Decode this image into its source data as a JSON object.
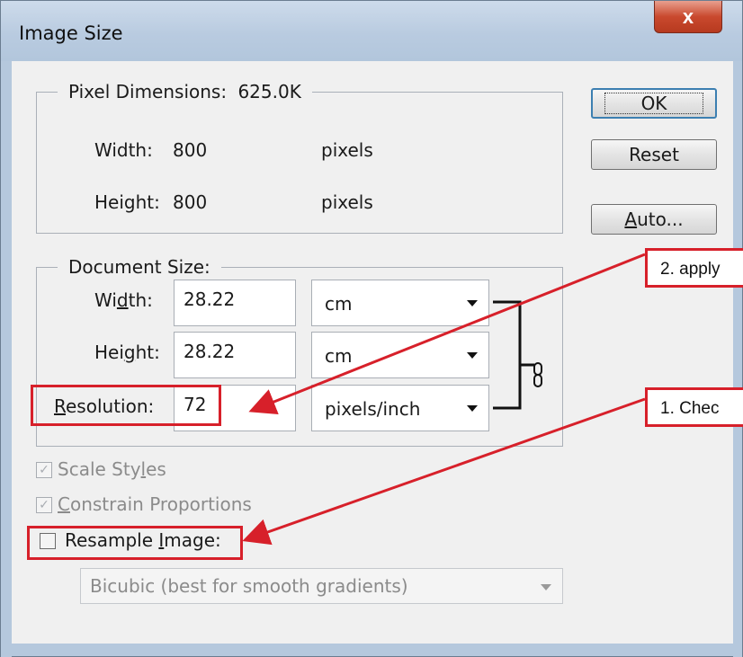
{
  "window": {
    "title": "Image Size",
    "close_glyph": "x"
  },
  "pixel_dimensions": {
    "legend": "Pixel Dimensions:",
    "size": "625.0K",
    "width_label": "Width:",
    "width_value": "800",
    "width_unit": "pixels",
    "height_label": "Height:",
    "height_value": "800",
    "height_unit": "pixels"
  },
  "document_size": {
    "legend": "Document Size:",
    "width_label_pre": "Wi",
    "width_label_ul": "d",
    "width_label_post": "th:",
    "width_value": "28.22",
    "width_unit": "cm",
    "height_label_pre": "Hei",
    "height_label_ul": "g",
    "height_label_post": "ht:",
    "height_value": "28.22",
    "height_unit": "cm",
    "resolution_label_ul": "R",
    "resolution_label_post": "esolution:",
    "resolution_value": "72",
    "resolution_unit": "pixels/inch",
    "link_icon": "chain-link-icon"
  },
  "buttons": {
    "ok": "OK",
    "reset": "Reset",
    "auto_ul": "A",
    "auto_post": "uto..."
  },
  "options": {
    "scale_styles_pre": "Scale Sty",
    "scale_styles_ul": "l",
    "scale_styles_post": "es",
    "scale_styles_checked": true,
    "constrain_ul": "C",
    "constrain_post": "onstrain Proportions",
    "constrain_checked": true,
    "resample_pre": "Resample ",
    "resample_ul": "I",
    "resample_post": "mage:",
    "resample_checked": false,
    "interpolation_value": "Bicubic (best for smooth gradients)"
  },
  "annotations": {
    "callout_2": "2. apply",
    "callout_1": "1. Chec",
    "accent_color": "#d7202a"
  }
}
